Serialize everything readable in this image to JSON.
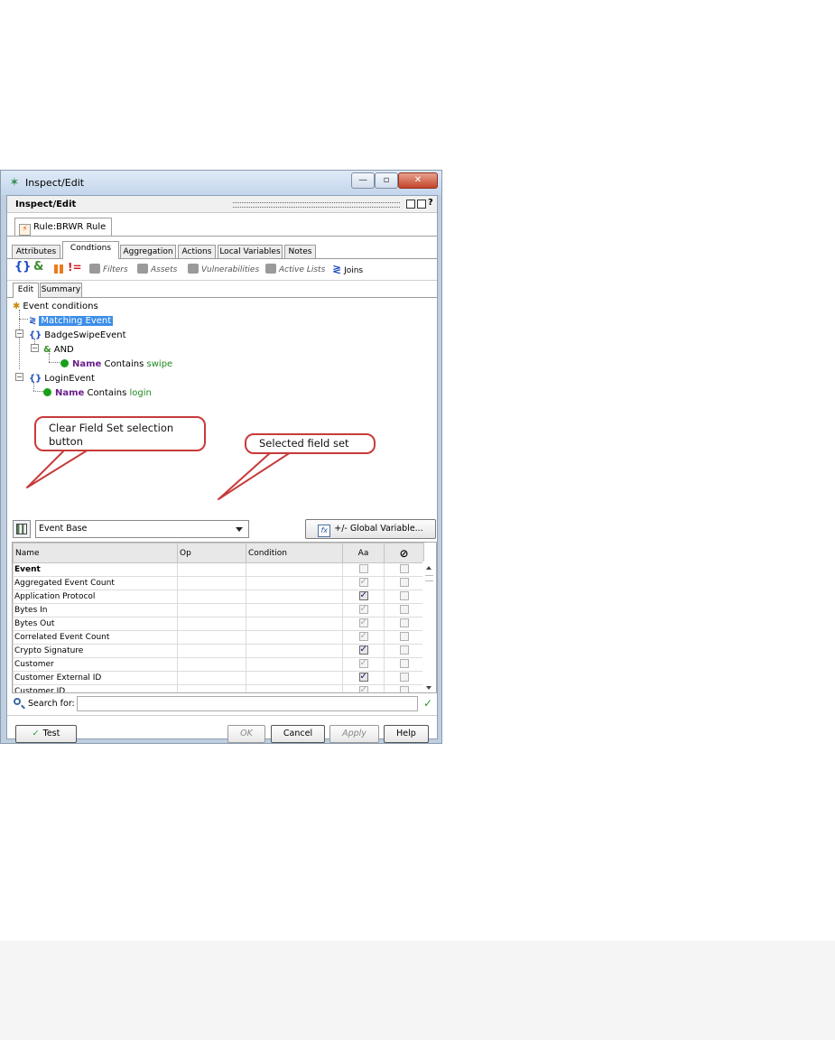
{
  "window": {
    "title": "Inspect/Edit",
    "minimize_glyph": "—",
    "maximize_glyph": "▫",
    "close_glyph": "✕"
  },
  "pane": {
    "title": "Inspect/Edit",
    "help_glyph": "?"
  },
  "rule_tab": {
    "label": "Rule:BRWR Rule"
  },
  "tabs": [
    {
      "label": "Attributes",
      "active": false
    },
    {
      "label": "Condtions",
      "active": true
    },
    {
      "label": "Aggregation",
      "active": false
    },
    {
      "label": "Actions",
      "active": false
    },
    {
      "label": "Local Variables",
      "active": false
    },
    {
      "label": "Notes",
      "active": false
    }
  ],
  "toolbar": {
    "brace_glyph": "{}",
    "and_glyph": "&",
    "not_glyph": "!=",
    "filters": "Filters",
    "assets": "Assets",
    "vulnerabilities": "Vulnerabilities",
    "active_lists": "Active Lists",
    "joins": "Joins"
  },
  "subtabs": [
    {
      "label": "Edit",
      "active": true
    },
    {
      "label": "Summary",
      "active": false
    }
  ],
  "tree": {
    "root": "Event conditions",
    "matching_event": "Matching Event",
    "badge_swipe_event": "BadgeSwipeEvent",
    "and_label": "AND",
    "cond1": {
      "field": "Name",
      "op": "Contains",
      "value": "swipe"
    },
    "login_event": "LoginEvent",
    "cond2": {
      "field": "Name",
      "op": "Contains",
      "value": "login"
    }
  },
  "callouts": {
    "clear_field_set": "Clear Field Set selection button",
    "selected_field_set": "Selected field set"
  },
  "field_set": {
    "selected": "Event Base",
    "global_variable_button": "+/- Global Variable..."
  },
  "grid": {
    "columns": [
      "Name",
      "Op",
      "Condition",
      "Aa",
      "⊘"
    ],
    "rows": [
      {
        "name": "Event",
        "group": true,
        "aa": "off",
        "neg": "off"
      },
      {
        "name": "Aggregated Event Count",
        "group": false,
        "aa": "dim",
        "neg": "off"
      },
      {
        "name": "Application Protocol",
        "group": false,
        "aa": "on",
        "neg": "off"
      },
      {
        "name": "Bytes In",
        "group": false,
        "aa": "dim",
        "neg": "off"
      },
      {
        "name": "Bytes Out",
        "group": false,
        "aa": "dim",
        "neg": "off"
      },
      {
        "name": "Correlated Event Count",
        "group": false,
        "aa": "dim",
        "neg": "off"
      },
      {
        "name": "Crypto Signature",
        "group": false,
        "aa": "on",
        "neg": "off"
      },
      {
        "name": "Customer",
        "group": false,
        "aa": "dim",
        "neg": "off"
      },
      {
        "name": "Customer External ID",
        "group": false,
        "aa": "on",
        "neg": "off"
      },
      {
        "name": "Customer ID",
        "group": false,
        "aa": "dim",
        "neg": "off"
      }
    ]
  },
  "search": {
    "label": "Search for:",
    "value": "",
    "ok_glyph": "✓"
  },
  "buttons": {
    "test": "Test",
    "ok": "OK",
    "cancel": "Cancel",
    "apply": "Apply",
    "help": "Help"
  }
}
